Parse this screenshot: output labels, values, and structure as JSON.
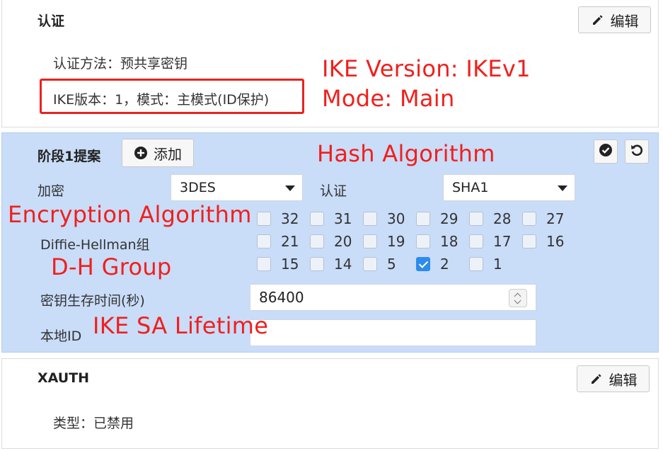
{
  "auth": {
    "title": "认证",
    "edit_label": "编辑",
    "method_line": "认证方法：预共享密钥",
    "ike_line": "IKE版本：1，模式：主模式(ID保护)"
  },
  "phase1": {
    "title": "阶段1提案",
    "add_label": "添加",
    "encryption_label": "加密",
    "encryption_value": "3DES",
    "auth_label": "认证",
    "auth_value": "SHA1",
    "dh_label": "Diffie-Hellman组",
    "dh_rows": [
      [
        {
          "n": "32",
          "checked": false
        },
        {
          "n": "31",
          "checked": false
        },
        {
          "n": "30",
          "checked": false
        },
        {
          "n": "29",
          "checked": false
        },
        {
          "n": "28",
          "checked": false
        },
        {
          "n": "27",
          "checked": false
        }
      ],
      [
        {
          "n": "21",
          "checked": false
        },
        {
          "n": "20",
          "checked": false
        },
        {
          "n": "19",
          "checked": false
        },
        {
          "n": "18",
          "checked": false
        },
        {
          "n": "17",
          "checked": false
        },
        {
          "n": "16",
          "checked": false
        }
      ],
      [
        {
          "n": "15",
          "checked": false
        },
        {
          "n": "14",
          "checked": false
        },
        {
          "n": "5",
          "checked": false
        },
        {
          "n": "2",
          "checked": true
        },
        {
          "n": "1",
          "checked": false
        }
      ]
    ],
    "lifetime_label": "密钥生存时间(秒)",
    "lifetime_value": "86400",
    "local_id_label": "本地ID",
    "local_id_value": ""
  },
  "xauth": {
    "title": "XAUTH",
    "edit_label": "编辑",
    "type_line": "类型：已禁用"
  },
  "annotations": {
    "ike_version": "IKE Version: IKEv1",
    "mode": "Mode: Main",
    "hash": "Hash Algorithm",
    "encryption": "Encryption Algorithm",
    "dh": "D-H Group",
    "lifetime": "IKE SA Lifetime"
  },
  "colors": {
    "annotation": "#f0201c",
    "phase1_bg": "#c9dcf8",
    "checked": "#2d8ceb"
  }
}
